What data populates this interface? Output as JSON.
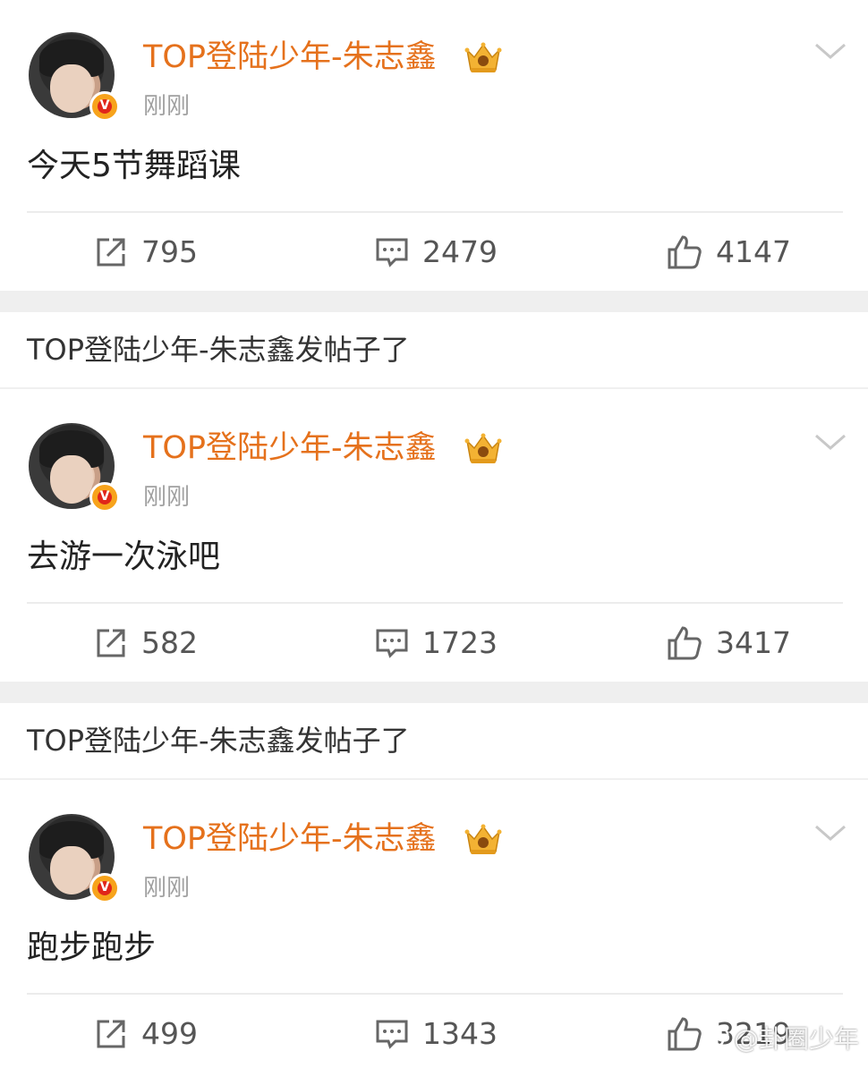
{
  "posts": [
    {
      "username": "TOP登陆少年-朱志鑫",
      "verified_badge": "V",
      "timestamp": "刚刚",
      "content": "今天5节舞蹈课",
      "reposts": "795",
      "comments": "2479",
      "likes": "4147"
    },
    {
      "username": "TOP登陆少年-朱志鑫",
      "verified_badge": "V",
      "timestamp": "刚刚",
      "content": "去游一次泳吧",
      "reposts": "582",
      "comments": "1723",
      "likes": "3417"
    },
    {
      "username": "TOP登陆少年-朱志鑫",
      "verified_badge": "V",
      "timestamp": "刚刚",
      "content": "跑步跑步",
      "reposts": "499",
      "comments": "1343",
      "likes": "3219"
    }
  ],
  "notices": [
    {
      "text": "TOP登陆少年-朱志鑫发帖子了"
    },
    {
      "text": "TOP登陆少年-朱志鑫发帖子了"
    }
  ],
  "watermark": {
    "text": "@卦圈少年",
    "icon": "weibo-logo-icon"
  },
  "icons": {
    "repost": "repost-icon",
    "comment": "comment-icon",
    "like": "like-icon",
    "more": "chevron-down-icon",
    "crown": "crown-badge-icon"
  },
  "colors": {
    "username": "#e5711c",
    "timestamp": "#a0a0a0",
    "separator": "#efefef",
    "verified": "#f7a31b"
  }
}
